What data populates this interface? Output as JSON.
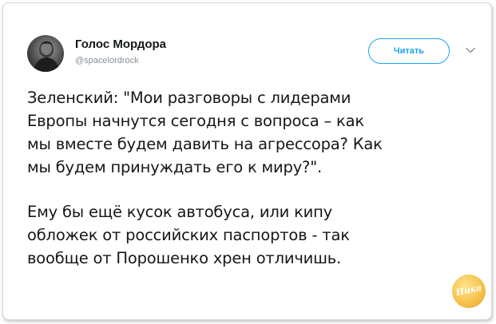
{
  "author": {
    "name": "Голос Мордора",
    "handle": "@spacelordrock",
    "avatar_icon": "avatar-photo"
  },
  "follow_button": {
    "label": "Читать",
    "color": "#1da1f2"
  },
  "menu_icon": "chevron-down-icon",
  "tweet": {
    "paragraph1": [
      "Зеленский: \"Мои разговоры с лидерами",
      "Европы начнутся сегодня с вопроса – как",
      "мы вместе будем давить на агрессора? Как",
      "мы будем принуждать его к миру?\"."
    ],
    "paragraph2": [
      "Ему бы ещё кусок автобуса, или кипу",
      "обложек от российских паспортов - так",
      "вообще от Порошенко хрен отличишь."
    ]
  },
  "watermark": {
    "text": "Ника"
  }
}
